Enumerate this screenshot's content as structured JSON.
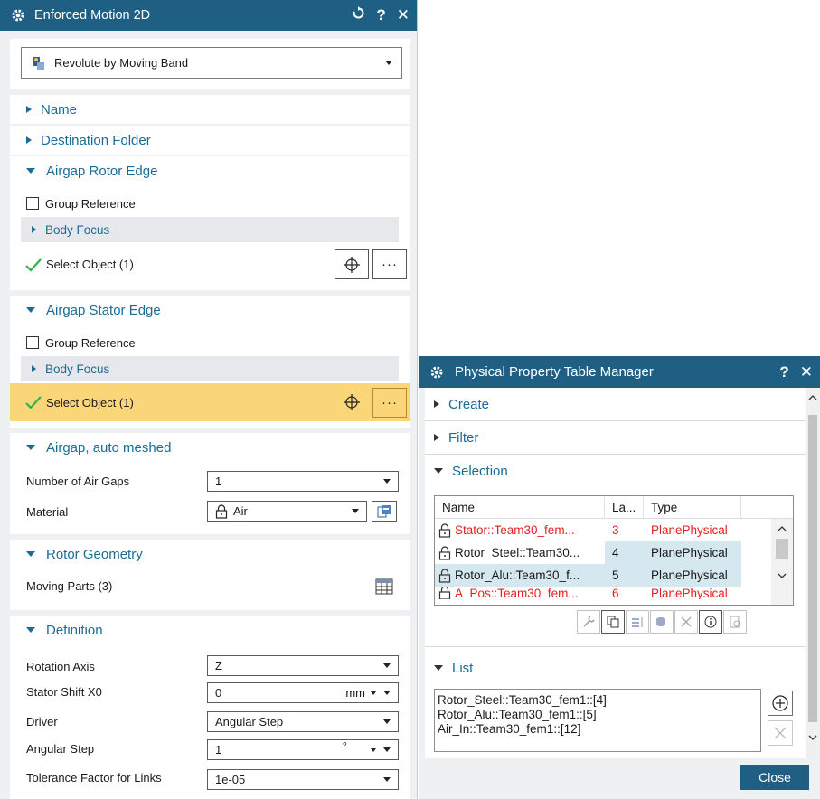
{
  "enforced_motion": {
    "title": "Enforced Motion 2D",
    "type_selector": {
      "value": "Revolute by Moving Band"
    },
    "sections": {
      "name": "Name",
      "destination_folder": "Destination Folder",
      "airgap_rotor_edge": "Airgap Rotor Edge",
      "airgap_stator_edge": "Airgap Stator Edge",
      "airgap_auto_meshed": "Airgap, auto meshed",
      "rotor_geometry": "Rotor Geometry",
      "definition": "Definition"
    },
    "rotor_edge": {
      "group_reference": "Group Reference",
      "body_focus": "Body Focus",
      "select_object": "Select Object (1)"
    },
    "stator_edge": {
      "group_reference": "Group Reference",
      "body_focus": "Body Focus",
      "select_object": "Select Object (1)"
    },
    "airgap": {
      "number_of_air_gaps_label": "Number of Air Gaps",
      "number_of_air_gaps_value": "1",
      "material_label": "Material",
      "material_value": "Air"
    },
    "rotor_geometry": {
      "moving_parts_label": "Moving Parts (3)"
    },
    "definition": {
      "rotation_axis_label": "Rotation Axis",
      "rotation_axis_value": "Z",
      "stator_shift_label": "Stator Shift X0",
      "stator_shift_value": "0",
      "stator_shift_unit": "mm",
      "driver_label": "Driver",
      "driver_value": "Angular Step",
      "angular_step_label": "Angular Step",
      "angular_step_value": "1",
      "angular_step_unit": "°",
      "tolerance_label": "Tolerance Factor for Links",
      "tolerance_value": "1e-05"
    }
  },
  "property_manager": {
    "title": "Physical Property Table Manager",
    "sections": {
      "create": "Create",
      "filter": "Filter",
      "selection": "Selection",
      "list": "List"
    },
    "table": {
      "headers": [
        "Name",
        "La...",
        "Type"
      ],
      "rows": [
        {
          "name": "Stator::Team30_fem...",
          "la": "3",
          "type": "PlanePhysical"
        },
        {
          "name": "Rotor_Steel::Team30...",
          "la": "4",
          "type": "PlanePhysical"
        },
        {
          "name": "Rotor_Alu::Team30_f...",
          "la": "5",
          "type": "PlanePhysical"
        },
        {
          "name": "A_Pos::Team30_fem...",
          "la": "6",
          "type": "PlanePhysical"
        }
      ]
    },
    "list_items": [
      "Rotor_Steel::Team30_fem1::[4]",
      "Rotor_Alu::Team30_fem1::[5]",
      "Air_In::Team30_fem1::[12]"
    ],
    "close_label": "Close"
  },
  "colors": {
    "title_bar": "#1f5f83",
    "section_text": "#1a6b96",
    "highlight_row": "#fbd679",
    "selected_row": "#d5e8f0",
    "error_text": "#e52020",
    "check_green": "#2fb34a"
  }
}
